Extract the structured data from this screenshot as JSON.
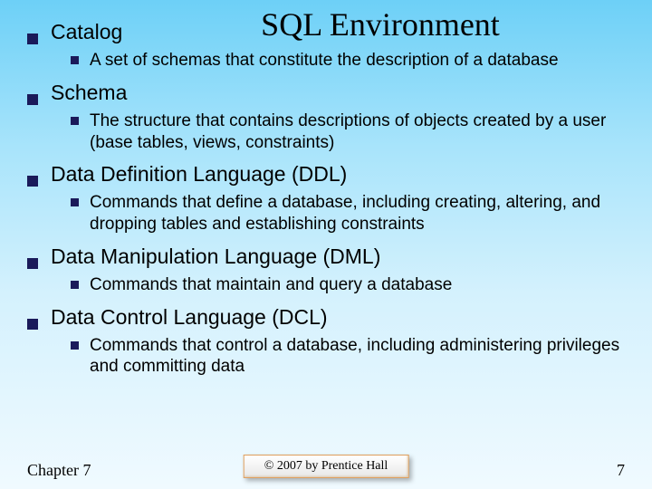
{
  "title": "SQL Environment",
  "items": [
    {
      "label": "Catalog",
      "sub": "A set of schemas that constitute the description of a database"
    },
    {
      "label": "Schema",
      "sub": "The structure that contains descriptions of objects created by a user (base tables, views, constraints)"
    },
    {
      "label": "Data Definition Language (DDL)",
      "sub": "Commands that define a database, including creating, altering, and dropping tables and establishing constraints"
    },
    {
      "label": "Data Manipulation Language (DML)",
      "sub": "Commands that maintain and query a database"
    },
    {
      "label": "Data Control Language (DCL)",
      "sub": "Commands that control a database, including administering privileges and committing data"
    }
  ],
  "footer": {
    "left": "Chapter 7",
    "center": "© 2007 by Prentice Hall",
    "right": "7"
  }
}
